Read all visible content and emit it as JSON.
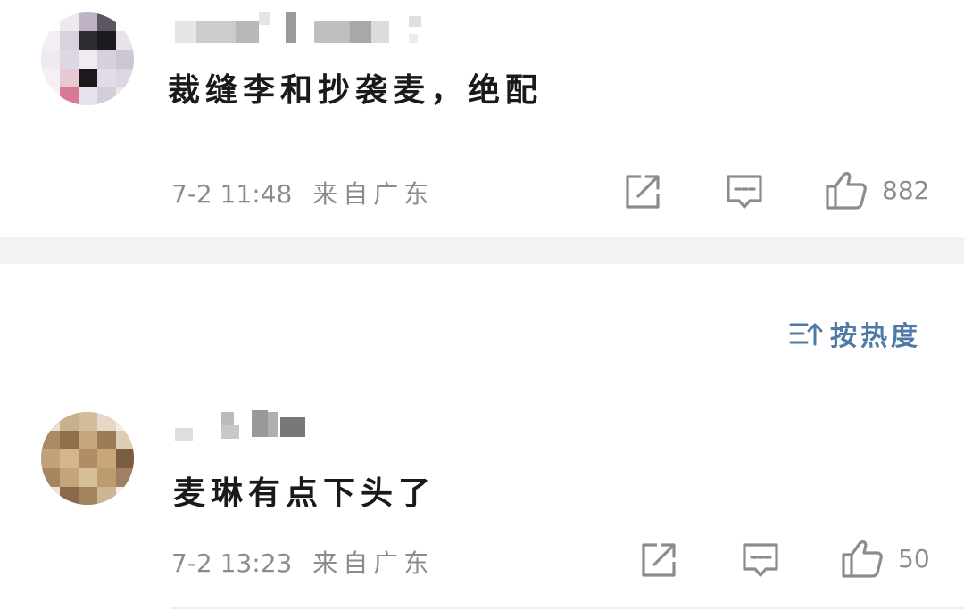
{
  "comments": [
    {
      "text": "裁缝李和抄袭麦，绝配",
      "date": "7-2",
      "time": "11:48",
      "location": "来自广东",
      "likes": "882"
    },
    {
      "text": "麦琳有点下头了",
      "date": "7-2",
      "time": "13:23",
      "location": "来自广东",
      "likes": "50"
    }
  ],
  "sort": {
    "label": "按热度"
  },
  "icons": {
    "share": "share-icon",
    "reply": "comment-icon",
    "like": "thumbs-up-icon",
    "sort": "sort-icon"
  },
  "colors": {
    "text": "#1a1a1a",
    "meta": "#8c8c8c",
    "accent": "#4f79a6",
    "band": "#f2f2f2"
  }
}
